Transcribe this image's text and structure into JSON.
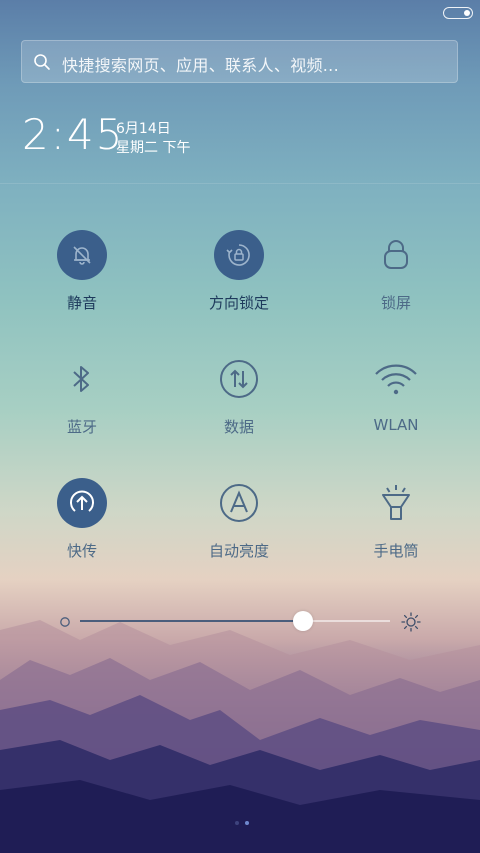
{
  "search": {
    "placeholder": "快捷搜索网页、应用、联系人、视频..."
  },
  "clock": {
    "time": "2:45",
    "date": "6月14日",
    "weekday": "星期二 下午"
  },
  "toggles": [
    {
      "label": "静音",
      "icon": "bell-muted-icon",
      "state": "on"
    },
    {
      "label": "方向锁定",
      "icon": "rotation-lock-icon",
      "state": "on"
    },
    {
      "label": "锁屏",
      "icon": "lock-icon",
      "state": "off"
    },
    {
      "label": "蓝牙",
      "icon": "bluetooth-icon",
      "state": "off"
    },
    {
      "label": "数据",
      "icon": "data-icon",
      "state": "off"
    },
    {
      "label": "WLAN",
      "icon": "wifi-icon",
      "state": "off"
    },
    {
      "label": "快传",
      "icon": "quick-transfer-icon",
      "state": "on"
    },
    {
      "label": "自动亮度",
      "icon": "auto-brightness-icon",
      "state": "off"
    },
    {
      "label": "手电筒",
      "icon": "flashlight-icon",
      "state": "off"
    }
  ],
  "brightness": {
    "level": 0.72
  },
  "pager": {
    "count": 2,
    "active": 1
  },
  "colors": {
    "active_circle": "#3b5f8b",
    "icon_off": "#4d6a87",
    "label_on": "#1e3a5c"
  }
}
